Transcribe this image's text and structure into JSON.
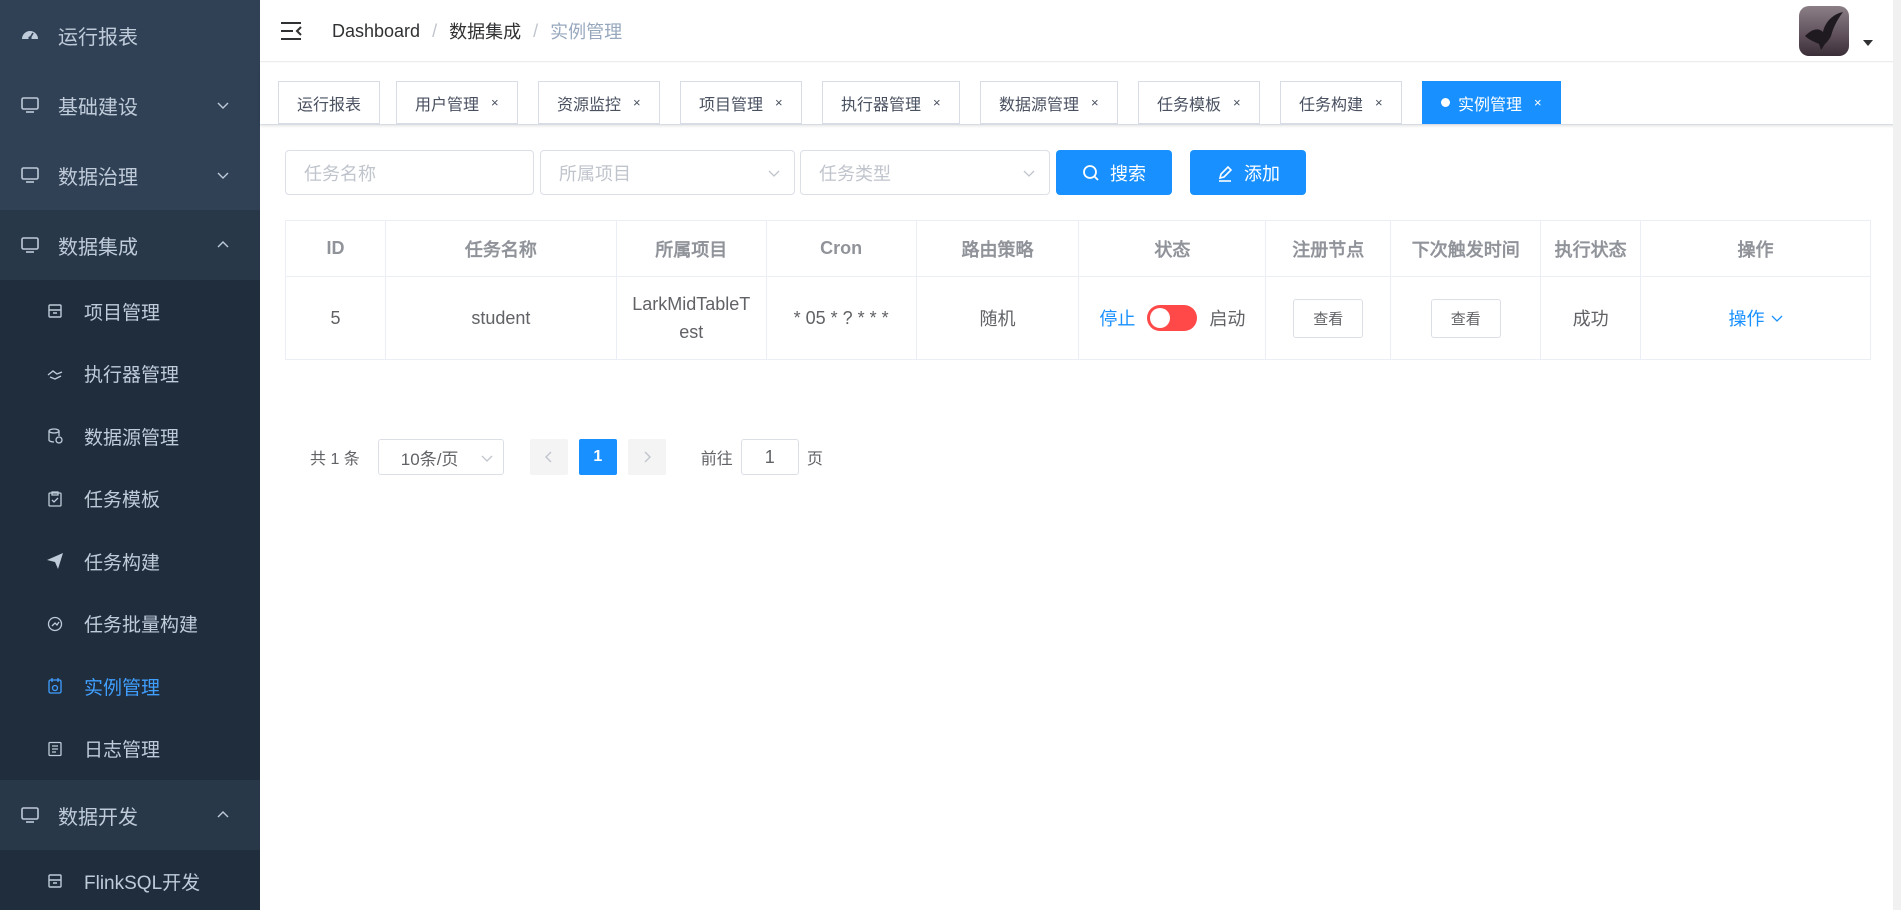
{
  "sidebar": {
    "top_items": [
      {
        "label": "运行报表",
        "icon": "dashboard-icon"
      },
      {
        "label": "基础建设",
        "icon": "monitor-icon",
        "chevron": "down"
      },
      {
        "label": "数据治理",
        "icon": "monitor-icon",
        "chevron": "down"
      },
      {
        "label": "数据集成",
        "icon": "monitor-icon",
        "chevron": "up"
      }
    ],
    "sub_items": [
      {
        "label": "项目管理",
        "icon": "project-icon"
      },
      {
        "label": "执行器管理",
        "icon": "executor-icon"
      },
      {
        "label": "数据源管理",
        "icon": "datasource-icon"
      },
      {
        "label": "任务模板",
        "icon": "template-icon"
      },
      {
        "label": "任务构建",
        "icon": "paper-plane-icon"
      },
      {
        "label": "任务批量构建",
        "icon": "batch-build-icon"
      },
      {
        "label": "实例管理",
        "icon": "instance-icon",
        "active": true
      },
      {
        "label": "日志管理",
        "icon": "log-icon"
      }
    ],
    "dev_group": {
      "label": "数据开发",
      "icon": "monitor-icon",
      "chevron": "up"
    },
    "dev_sub_items": [
      {
        "label": "FlinkSQL开发",
        "icon": "project-icon"
      }
    ]
  },
  "navbar": {
    "breadcrumb": [
      "Dashboard",
      "数据集成",
      "实例管理"
    ],
    "separator": "/"
  },
  "tags": [
    {
      "label": "运行报表",
      "closable": false
    },
    {
      "label": "用户管理",
      "closable": true
    },
    {
      "label": "资源监控",
      "closable": true
    },
    {
      "label": "项目管理",
      "closable": true
    },
    {
      "label": "执行器管理",
      "closable": true
    },
    {
      "label": "数据源管理",
      "closable": true
    },
    {
      "label": "任务模板",
      "closable": true
    },
    {
      "label": "任务构建",
      "closable": true
    },
    {
      "label": "实例管理",
      "closable": true,
      "active": true
    }
  ],
  "tag_close": "×",
  "filters": {
    "task_name_placeholder": "任务名称",
    "project_placeholder": "所属项目",
    "task_type_placeholder": "任务类型",
    "search_label": "搜索",
    "add_label": "添加"
  },
  "table": {
    "headers": [
      "ID",
      "任务名称",
      "所属项目",
      "Cron",
      "路由策略",
      "状态",
      "注册节点",
      "下次触发时间",
      "执行状态",
      "操作"
    ],
    "rows": [
      {
        "id": "5",
        "task_name": "student",
        "project": "LarkMidTableTest",
        "cron": "* 05 * ? * * *",
        "route": "随机",
        "status_off": "停止",
        "status_on": "启动",
        "switch_on": false,
        "nodes_btn": "查看",
        "next_trigger_btn": "查看",
        "exec_status": "成功",
        "op_label": "操作"
      }
    ]
  },
  "pagination": {
    "total_text": "共 1 条",
    "page_size": "10条/页",
    "current_page": "1",
    "goto_prefix": "前往",
    "goto_value": "1",
    "goto_suffix": "页"
  },
  "colors": {
    "sidebar_bg": "#304156",
    "submenu_bg": "#1f2d3d",
    "primary": "#1890ff",
    "switch_off": "#ff4949"
  }
}
